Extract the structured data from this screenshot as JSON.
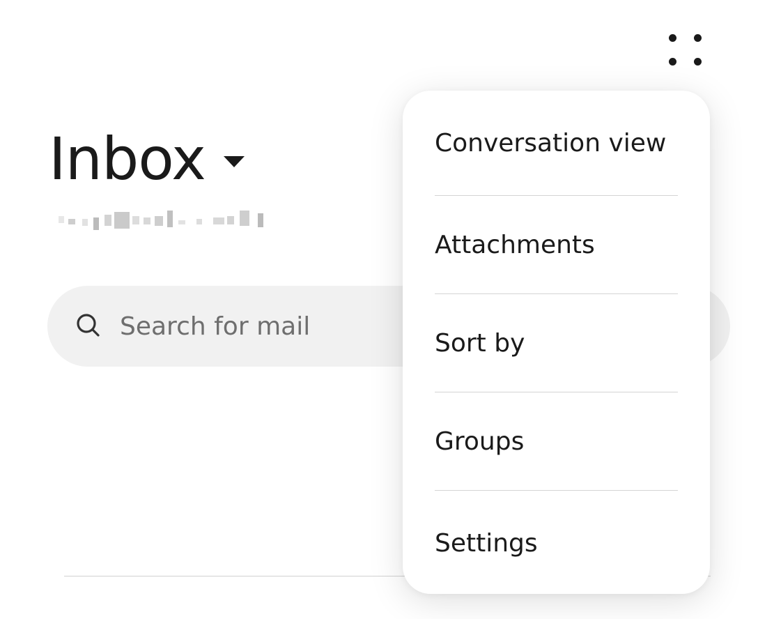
{
  "header": {
    "title": "Inbox"
  },
  "search": {
    "placeholder": "Search for mail"
  },
  "overflow_menu": {
    "items": [
      {
        "label": "Conversation view"
      },
      {
        "label": "Attachments"
      },
      {
        "label": "Sort by"
      },
      {
        "label": "Groups"
      },
      {
        "label": "Settings"
      }
    ]
  },
  "icons": {
    "more": "more-options-icon",
    "search": "search-icon",
    "caret": "dropdown-caret-icon"
  },
  "colors": {
    "text": "#1a1a1a",
    "placeholder": "#6e6e6e",
    "search_background": "#f1f1f1",
    "divider": "#d4d4d4"
  }
}
